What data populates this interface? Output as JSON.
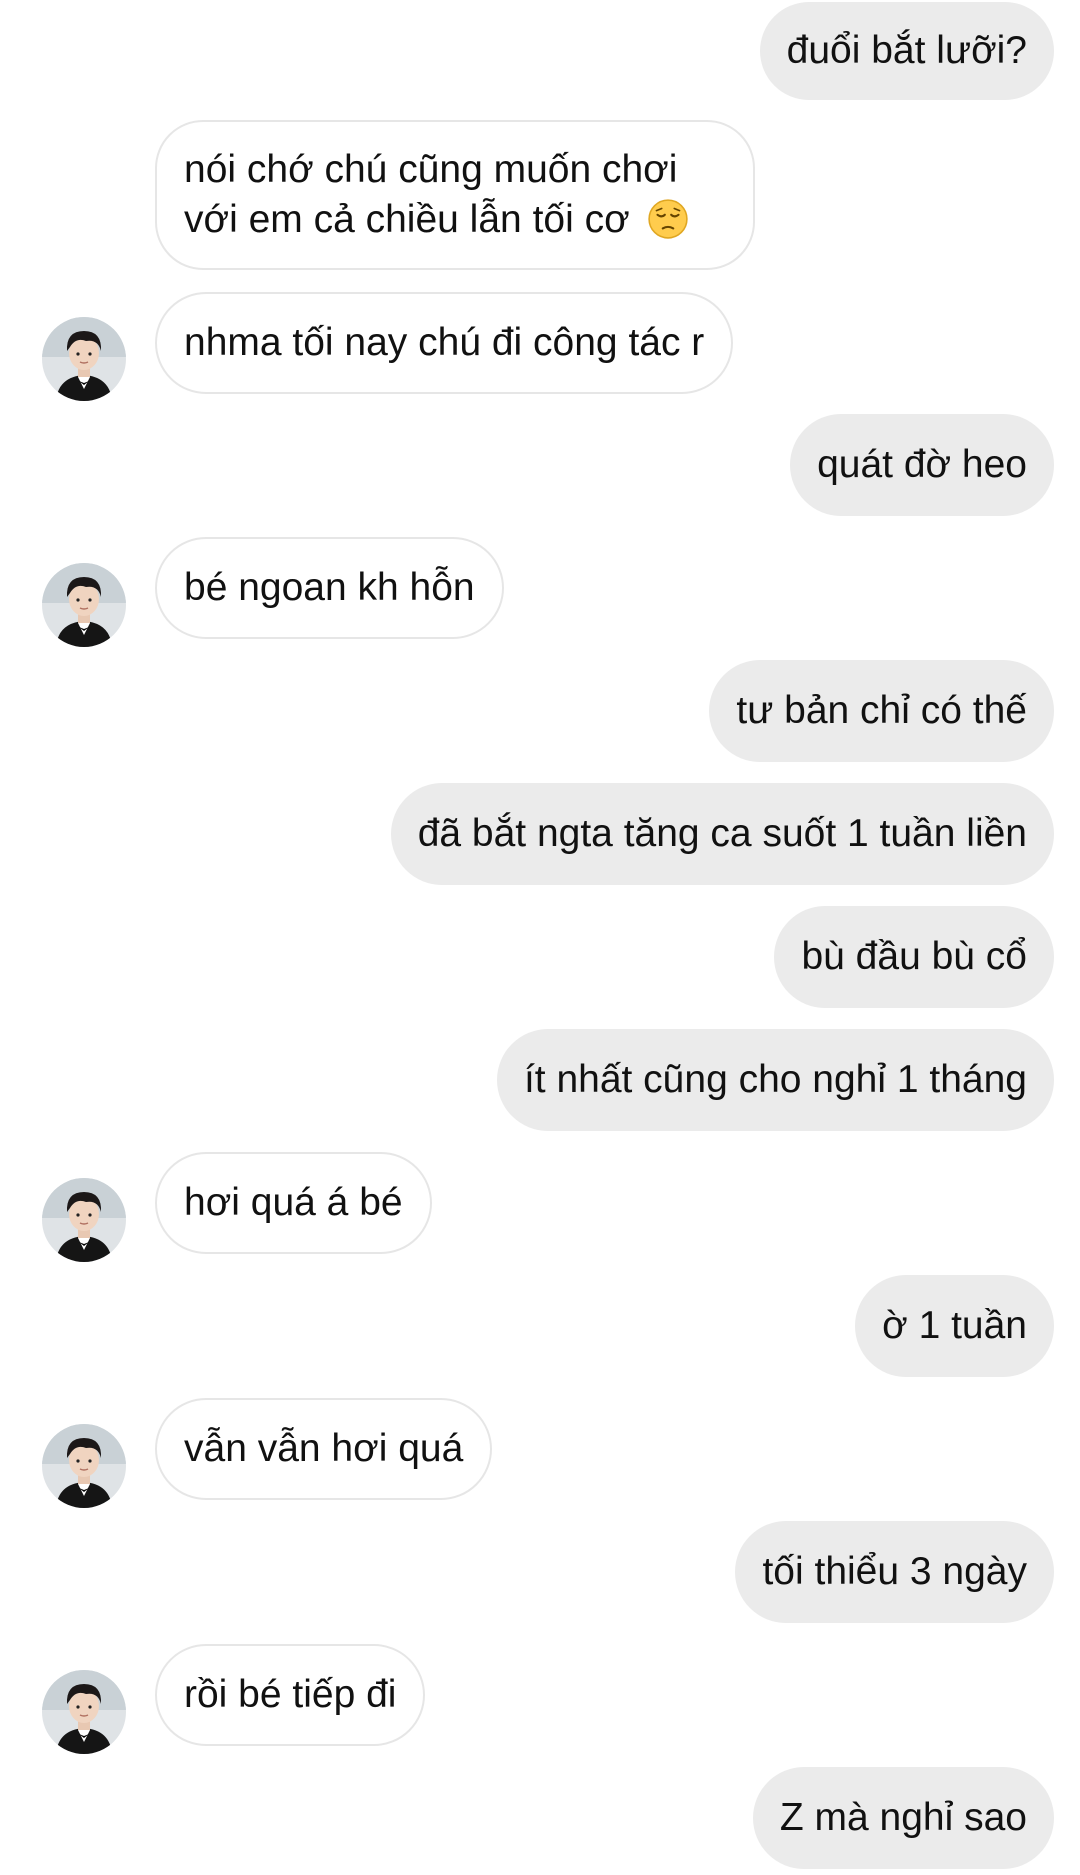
{
  "conversation": {
    "messages": [
      {
        "side": "out",
        "text": "đuổi bắt lưỡi?"
      },
      {
        "side": "in",
        "text": "nói chớ chú cũng muốn chơi với em cả chiều lẫn tối cơ",
        "emoji": "pensive-face-emoji",
        "avatar": false
      },
      {
        "side": "in",
        "text": "nhma tối nay chú đi công tác r",
        "avatar": true
      },
      {
        "side": "out",
        "text": "quát đờ heo"
      },
      {
        "side": "in",
        "text": "bé ngoan kh hỗn",
        "avatar": true
      },
      {
        "side": "out",
        "text": "tư bản chỉ có thế"
      },
      {
        "side": "out",
        "text": "đã bắt ngta tăng ca suốt 1 tuần liền"
      },
      {
        "side": "out",
        "text": "bù đầu bù cổ"
      },
      {
        "side": "out",
        "text": "ít nhất cũng cho nghỉ 1 tháng"
      },
      {
        "side": "in",
        "text": "hơi quá á bé",
        "avatar": true
      },
      {
        "side": "out",
        "text": "ờ 1 tuần"
      },
      {
        "side": "in",
        "text": "vẫn vẫn hơi quá",
        "avatar": true
      },
      {
        "side": "out",
        "text": "tối thiểu 3 ngày"
      },
      {
        "side": "in",
        "text": "rồi bé tiếp đi",
        "avatar": true
      },
      {
        "side": "out",
        "text": "Z mà nghỉ sao"
      }
    ]
  },
  "colors": {
    "outgoing_bubble": "#ebebeb",
    "incoming_bubble": "#ffffff",
    "incoming_border": "#e6e6e6",
    "text": "#111111"
  },
  "icons": {
    "avatar": "contact-avatar",
    "emoji": "pensive-face-emoji"
  }
}
